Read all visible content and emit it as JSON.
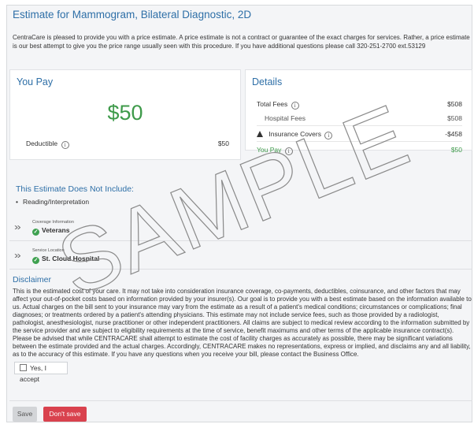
{
  "title": "Estimate for Mammogram, Bilateral Diagnostic, 2D",
  "intro": "CentraCare is pleased to provide you with a price estimate.  A price estimate is not a contract or guarantee of the exact charges for services.  Rather, a price estimate is our best attempt to give you the price range usually seen with this procedure. If you have additional questions please call 320-251-2700 ext.53129",
  "you_pay_card": {
    "heading": "You Pay",
    "amount": "$50",
    "deductible_label": "Deductible",
    "deductible_value": "$50"
  },
  "details_card": {
    "heading": "Details",
    "total_fees_label": "Total Fees",
    "total_fees_value": "$508",
    "hospital_fees_label": "Hospital Fees",
    "hospital_fees_value": "$508",
    "insurance_label": "Insurance Covers",
    "insurance_value": "-$458",
    "you_pay_label": "You Pay",
    "you_pay_value": "$50"
  },
  "not_included": {
    "heading": "This Estimate Does Not Include:",
    "items": [
      "Reading/Interpretation"
    ]
  },
  "coverage": {
    "label": "Coverage Information",
    "value": "Veterans"
  },
  "location": {
    "label": "Service Location",
    "value": "St. Cloud Hospital"
  },
  "disclaimer": {
    "heading": "Disclaimer",
    "body": "This is the estimated cost of your care. It may not take into consideration insurance coverage, co-payments, deductibles, coinsurance, and other factors that may affect your out-of-pocket costs based on information provided by your insurer(s). Our goal is to provide you with a best estimate based on the information available to us. Actual charges on the bill sent to your insurance may vary from the estimate as a result of a patient's medical conditions; circumstances or complications; final diagnoses; or treatments ordered by a patient's attending physicians. This estimate may not include service fees, such as those provided by a radiologist, pathologist, anesthesiologist, nurse practitioner or other independent practitioners. All claims are subject to medical review according to the information submitted by the service provider and are subject to eligibility requirements at the time of service, benefit maximums and other terms of the applicable insurance contract(s). Please be advised that while CENTRACARE shall attempt to estimate the cost of facility charges as accurately as possible, there may be significant variations between the estimate provided and the actual charges. Accordingly, CENTRACARE makes no representations, express or implied, and disclaims any and all liability, as to the accuracy of this estimate. If you have any questions when you receive your bill, please contact the Business Office."
  },
  "accept_label": "Yes, I accept",
  "buttons": {
    "save": "Save",
    "dont_save": "Don't save"
  },
  "watermark": "SAMPLE",
  "icons": {
    "info": "info-icon",
    "warning": "warning-icon",
    "check": "check-circle-icon",
    "chevron": "chevron-double-down-icon"
  },
  "colors": {
    "accent": "#2e6fa7",
    "green": "#3e9a4a",
    "danger": "#d9424e"
  }
}
